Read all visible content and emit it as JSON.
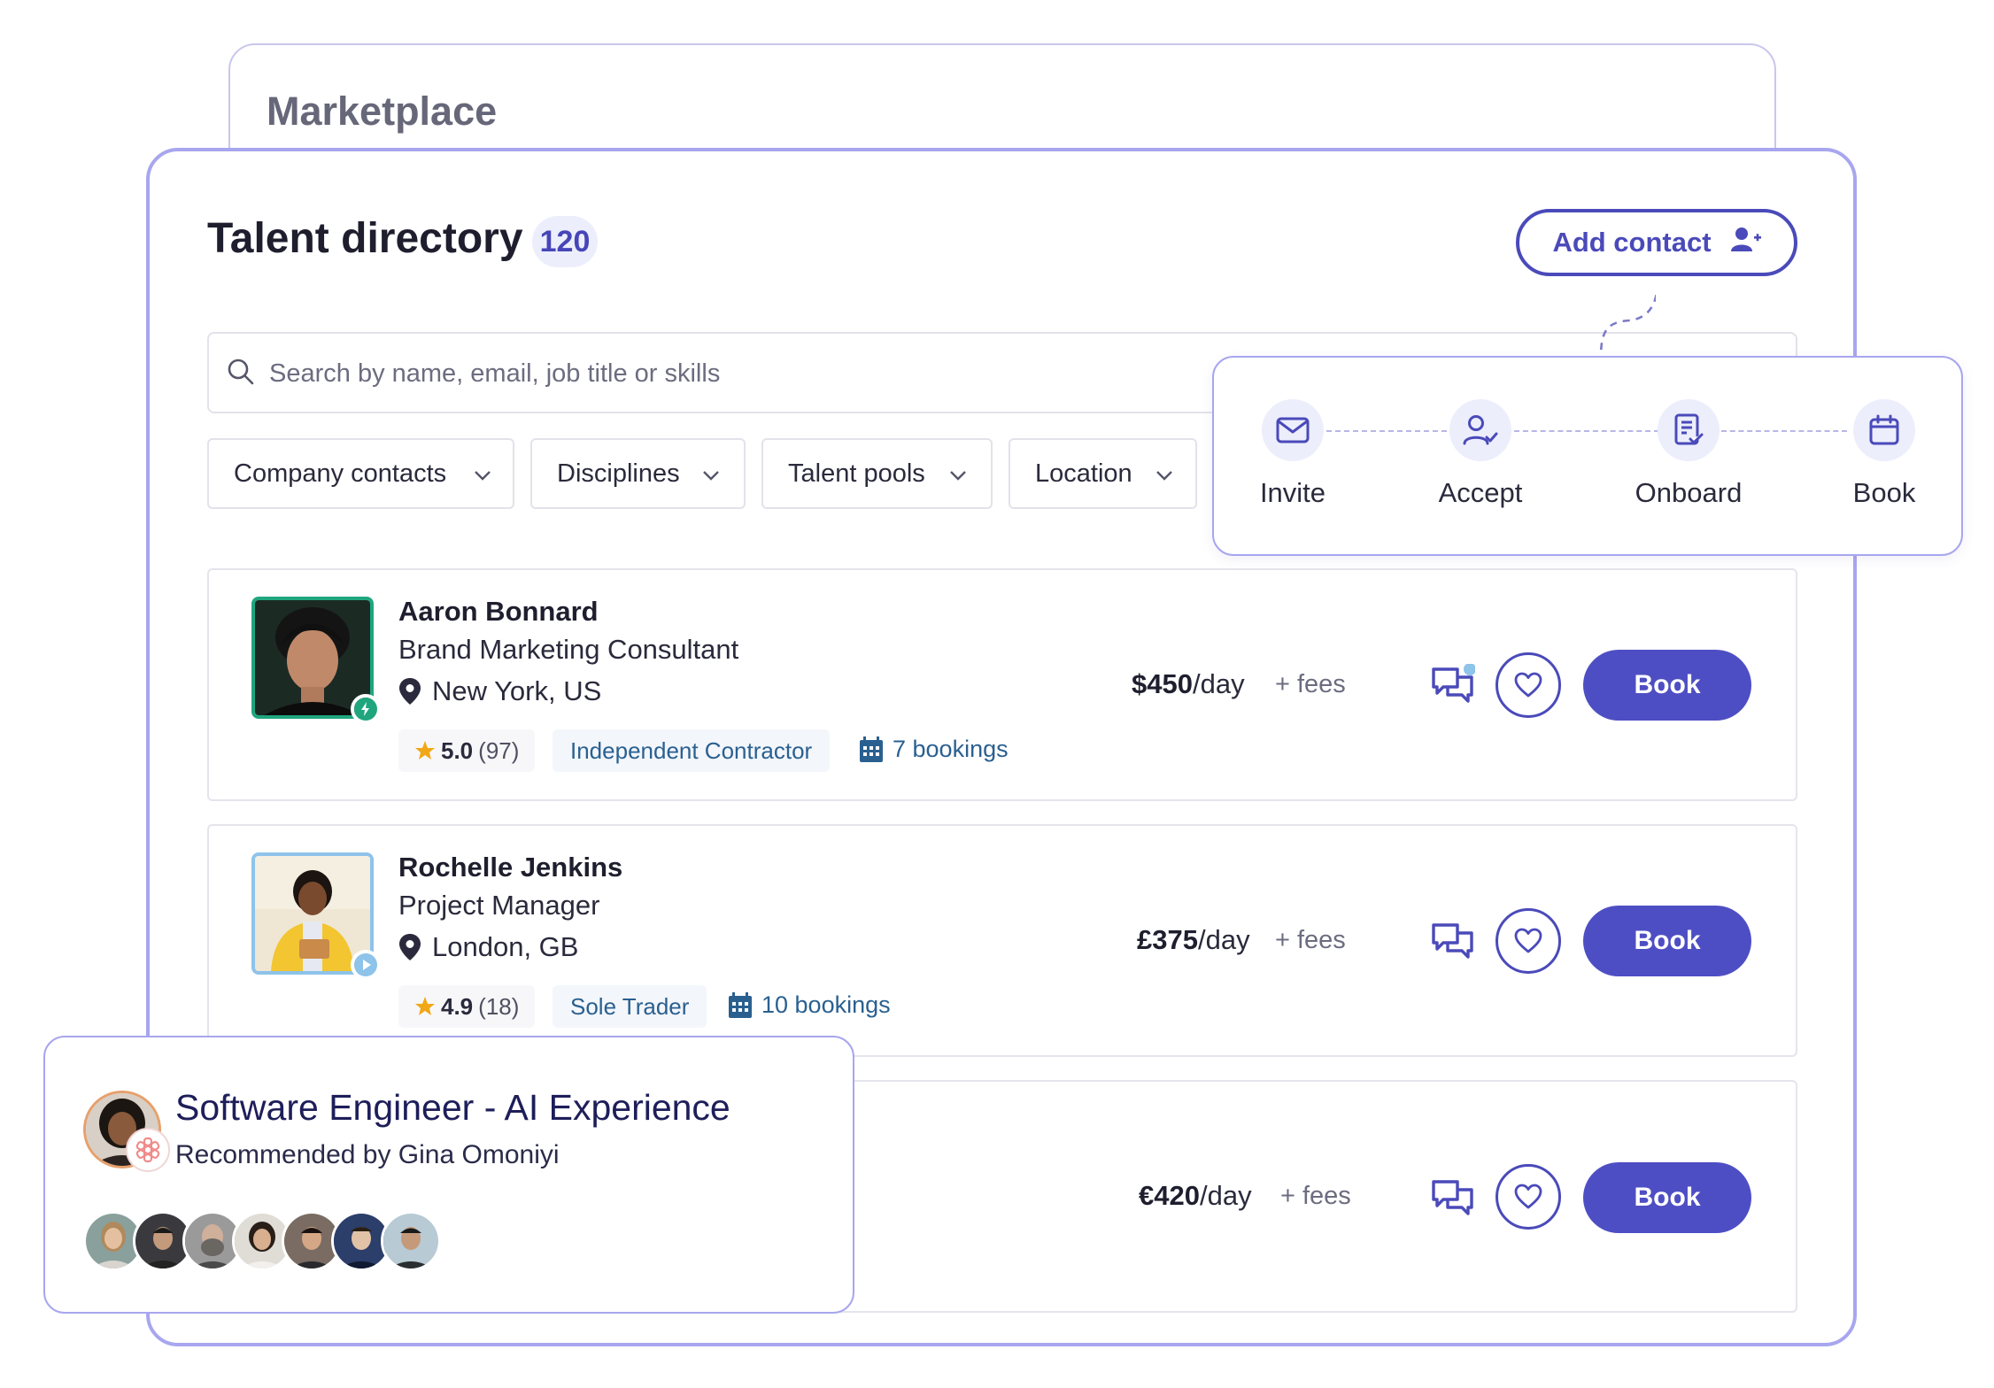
{
  "back_card": {
    "title": "Marketplace"
  },
  "header": {
    "title": "Talent directory",
    "count": "120",
    "add_contact_label": "Add contact"
  },
  "search": {
    "placeholder": "Search by name, email, job title or skills"
  },
  "filters": [
    {
      "label": "Company contacts"
    },
    {
      "label": "Disciplines"
    },
    {
      "label": "Talent pools"
    },
    {
      "label": "Location"
    }
  ],
  "flow": {
    "steps": [
      {
        "label": "Invite",
        "icon": "envelope-icon"
      },
      {
        "label": "Accept",
        "icon": "user-check-icon"
      },
      {
        "label": "Onboard",
        "icon": "document-check-icon"
      },
      {
        "label": "Book",
        "icon": "calendar-icon"
      }
    ]
  },
  "talent": [
    {
      "name": "Aaron Bonnard",
      "job": "Brand Marketing Consultant",
      "location": "New York, US",
      "rating": "5.0",
      "reviews": "(97)",
      "type": "Independent Contractor",
      "bookings": "7 bookings",
      "rate": "$450",
      "per": "/day",
      "fees": "+ fees",
      "book_label": "Book",
      "status_color": "#1fa67f"
    },
    {
      "name": "Rochelle Jenkins",
      "job": "Project Manager",
      "location": "London, GB",
      "rating": "4.9",
      "reviews": "(18)",
      "type": "Sole Trader",
      "bookings": "10 bookings",
      "rate": "£375",
      "per": "/day",
      "fees": "+ fees",
      "book_label": "Book",
      "status_color": "#8ec3ea"
    },
    {
      "rate": "€420",
      "per": "/day",
      "fees": "+ fees",
      "book_label": "Book"
    }
  ],
  "recommendation": {
    "title": "Software Engineer - AI Experience",
    "subtitle": "Recommended by Gina Omoniyi"
  },
  "colors": {
    "accent": "#4e4ec4",
    "accent_border": "#a8a6ee",
    "chip_blue": "#2a6090",
    "star": "#f0a818"
  }
}
